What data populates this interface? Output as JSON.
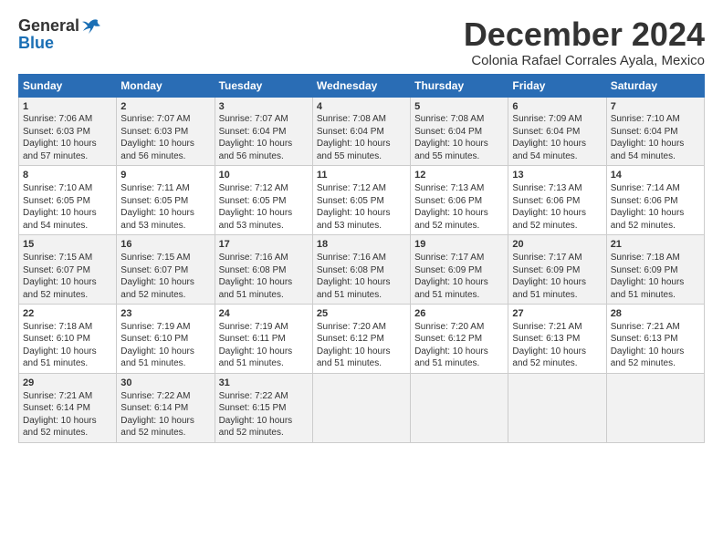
{
  "logo": {
    "general": "General",
    "blue": "Blue"
  },
  "title": "December 2024",
  "subtitle": "Colonia Rafael Corrales Ayala, Mexico",
  "days": [
    "Sunday",
    "Monday",
    "Tuesday",
    "Wednesday",
    "Thursday",
    "Friday",
    "Saturday"
  ],
  "weeks": [
    [
      {
        "day": "1",
        "rise": "Sunrise: 7:06 AM",
        "set": "Sunset: 6:03 PM",
        "daylight": "Daylight: 10 hours and 57 minutes."
      },
      {
        "day": "2",
        "rise": "Sunrise: 7:07 AM",
        "set": "Sunset: 6:03 PM",
        "daylight": "Daylight: 10 hours and 56 minutes."
      },
      {
        "day": "3",
        "rise": "Sunrise: 7:07 AM",
        "set": "Sunset: 6:04 PM",
        "daylight": "Daylight: 10 hours and 56 minutes."
      },
      {
        "day": "4",
        "rise": "Sunrise: 7:08 AM",
        "set": "Sunset: 6:04 PM",
        "daylight": "Daylight: 10 hours and 55 minutes."
      },
      {
        "day": "5",
        "rise": "Sunrise: 7:08 AM",
        "set": "Sunset: 6:04 PM",
        "daylight": "Daylight: 10 hours and 55 minutes."
      },
      {
        "day": "6",
        "rise": "Sunrise: 7:09 AM",
        "set": "Sunset: 6:04 PM",
        "daylight": "Daylight: 10 hours and 54 minutes."
      },
      {
        "day": "7",
        "rise": "Sunrise: 7:10 AM",
        "set": "Sunset: 6:04 PM",
        "daylight": "Daylight: 10 hours and 54 minutes."
      }
    ],
    [
      {
        "day": "8",
        "rise": "Sunrise: 7:10 AM",
        "set": "Sunset: 6:05 PM",
        "daylight": "Daylight: 10 hours and 54 minutes."
      },
      {
        "day": "9",
        "rise": "Sunrise: 7:11 AM",
        "set": "Sunset: 6:05 PM",
        "daylight": "Daylight: 10 hours and 53 minutes."
      },
      {
        "day": "10",
        "rise": "Sunrise: 7:12 AM",
        "set": "Sunset: 6:05 PM",
        "daylight": "Daylight: 10 hours and 53 minutes."
      },
      {
        "day": "11",
        "rise": "Sunrise: 7:12 AM",
        "set": "Sunset: 6:05 PM",
        "daylight": "Daylight: 10 hours and 53 minutes."
      },
      {
        "day": "12",
        "rise": "Sunrise: 7:13 AM",
        "set": "Sunset: 6:06 PM",
        "daylight": "Daylight: 10 hours and 52 minutes."
      },
      {
        "day": "13",
        "rise": "Sunrise: 7:13 AM",
        "set": "Sunset: 6:06 PM",
        "daylight": "Daylight: 10 hours and 52 minutes."
      },
      {
        "day": "14",
        "rise": "Sunrise: 7:14 AM",
        "set": "Sunset: 6:06 PM",
        "daylight": "Daylight: 10 hours and 52 minutes."
      }
    ],
    [
      {
        "day": "15",
        "rise": "Sunrise: 7:15 AM",
        "set": "Sunset: 6:07 PM",
        "daylight": "Daylight: 10 hours and 52 minutes."
      },
      {
        "day": "16",
        "rise": "Sunrise: 7:15 AM",
        "set": "Sunset: 6:07 PM",
        "daylight": "Daylight: 10 hours and 52 minutes."
      },
      {
        "day": "17",
        "rise": "Sunrise: 7:16 AM",
        "set": "Sunset: 6:08 PM",
        "daylight": "Daylight: 10 hours and 51 minutes."
      },
      {
        "day": "18",
        "rise": "Sunrise: 7:16 AM",
        "set": "Sunset: 6:08 PM",
        "daylight": "Daylight: 10 hours and 51 minutes."
      },
      {
        "day": "19",
        "rise": "Sunrise: 7:17 AM",
        "set": "Sunset: 6:09 PM",
        "daylight": "Daylight: 10 hours and 51 minutes."
      },
      {
        "day": "20",
        "rise": "Sunrise: 7:17 AM",
        "set": "Sunset: 6:09 PM",
        "daylight": "Daylight: 10 hours and 51 minutes."
      },
      {
        "day": "21",
        "rise": "Sunrise: 7:18 AM",
        "set": "Sunset: 6:09 PM",
        "daylight": "Daylight: 10 hours and 51 minutes."
      }
    ],
    [
      {
        "day": "22",
        "rise": "Sunrise: 7:18 AM",
        "set": "Sunset: 6:10 PM",
        "daylight": "Daylight: 10 hours and 51 minutes."
      },
      {
        "day": "23",
        "rise": "Sunrise: 7:19 AM",
        "set": "Sunset: 6:10 PM",
        "daylight": "Daylight: 10 hours and 51 minutes."
      },
      {
        "day": "24",
        "rise": "Sunrise: 7:19 AM",
        "set": "Sunset: 6:11 PM",
        "daylight": "Daylight: 10 hours and 51 minutes."
      },
      {
        "day": "25",
        "rise": "Sunrise: 7:20 AM",
        "set": "Sunset: 6:12 PM",
        "daylight": "Daylight: 10 hours and 51 minutes."
      },
      {
        "day": "26",
        "rise": "Sunrise: 7:20 AM",
        "set": "Sunset: 6:12 PM",
        "daylight": "Daylight: 10 hours and 51 minutes."
      },
      {
        "day": "27",
        "rise": "Sunrise: 7:21 AM",
        "set": "Sunset: 6:13 PM",
        "daylight": "Daylight: 10 hours and 52 minutes."
      },
      {
        "day": "28",
        "rise": "Sunrise: 7:21 AM",
        "set": "Sunset: 6:13 PM",
        "daylight": "Daylight: 10 hours and 52 minutes."
      }
    ],
    [
      {
        "day": "29",
        "rise": "Sunrise: 7:21 AM",
        "set": "Sunset: 6:14 PM",
        "daylight": "Daylight: 10 hours and 52 minutes."
      },
      {
        "day": "30",
        "rise": "Sunrise: 7:22 AM",
        "set": "Sunset: 6:14 PM",
        "daylight": "Daylight: 10 hours and 52 minutes."
      },
      {
        "day": "31",
        "rise": "Sunrise: 7:22 AM",
        "set": "Sunset: 6:15 PM",
        "daylight": "Daylight: 10 hours and 52 minutes."
      },
      null,
      null,
      null,
      null
    ]
  ]
}
